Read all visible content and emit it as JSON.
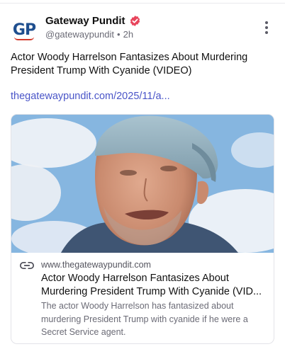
{
  "account": {
    "display_name": "Gateway Pundit",
    "handle": "@gatewaypundit",
    "separator": "•",
    "timestamp": "2h",
    "avatar_text_g": "G",
    "avatar_text_p": "P",
    "verified_color": "#e8455c"
  },
  "post": {
    "text": "Actor Woody Harrelson Fantasizes About Murdering President Trump With Cyanide (VIDEO)",
    "link_text": "thegatewaypundit.com/2025/11/a..."
  },
  "card": {
    "domain": "www.thegatewaypundit.com",
    "title_line1": "Actor Woody Harrelson Fantasizes About",
    "title_line2": "Murdering President Trump With Cyanide (VID...",
    "description": "The actor Woody Harrelson has fantasized about murdering President Trump with cyanide if he were a Secret Service agent.",
    "image_subject": "man-in-light-blue-cap-photo"
  },
  "icons": {
    "verified": "verified-badge-icon",
    "more": "more-vertical-icon",
    "link": "link-icon"
  },
  "colors": {
    "link": "#4a55c8",
    "muted": "#6b6b76",
    "brand_blue": "#1f4f8f",
    "brand_red": "#d33a2c"
  }
}
